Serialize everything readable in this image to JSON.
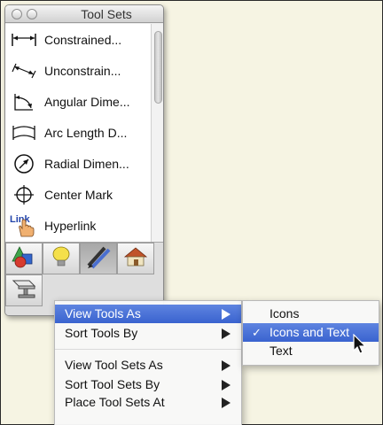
{
  "palette": {
    "title": "Tool Sets",
    "tools": [
      {
        "label": "Constrained...",
        "icon": "constrained-dimension-icon"
      },
      {
        "label": "Unconstrain...",
        "icon": "unconstrained-dimension-icon"
      },
      {
        "label": "Angular Dime...",
        "icon": "angular-dimension-icon"
      },
      {
        "label": "Arc Length D...",
        "icon": "arc-length-dimension-icon"
      },
      {
        "label": "Radial Dimen...",
        "icon": "radial-dimension-icon"
      },
      {
        "label": "Center Mark",
        "icon": "center-mark-icon"
      },
      {
        "label": "Hyperlink",
        "icon": "hyperlink-icon",
        "icon_text": "Link"
      }
    ],
    "toolsets": [
      {
        "icon": "shapes-toolset-icon",
        "active": false
      },
      {
        "icon": "lightbulb-toolset-icon",
        "active": false
      },
      {
        "icon": "pencil-toolset-icon",
        "active": true
      },
      {
        "icon": "house-toolset-icon",
        "active": false
      },
      {
        "icon": "beam-toolset-icon",
        "active": false
      }
    ]
  },
  "context_menu": {
    "items": [
      {
        "label": "View Tools As",
        "highlighted": true
      },
      {
        "label": "Sort Tools By",
        "highlighted": false
      },
      {
        "label": "View Tool Sets As",
        "highlighted": false
      },
      {
        "label": "Sort Tool Sets By",
        "highlighted": false
      },
      {
        "label": "Place Tool Sets At",
        "highlighted": false
      }
    ]
  },
  "submenu": {
    "items": [
      {
        "label": "Icons",
        "checked": false,
        "highlighted": false
      },
      {
        "label": "Icons and Text",
        "checked": true,
        "highlighted": true
      },
      {
        "label": "Text",
        "checked": false,
        "highlighted": false
      }
    ],
    "check_glyph": "✓"
  },
  "colors": {
    "highlight": "#3a63cf",
    "background": "#f6f4e3"
  }
}
